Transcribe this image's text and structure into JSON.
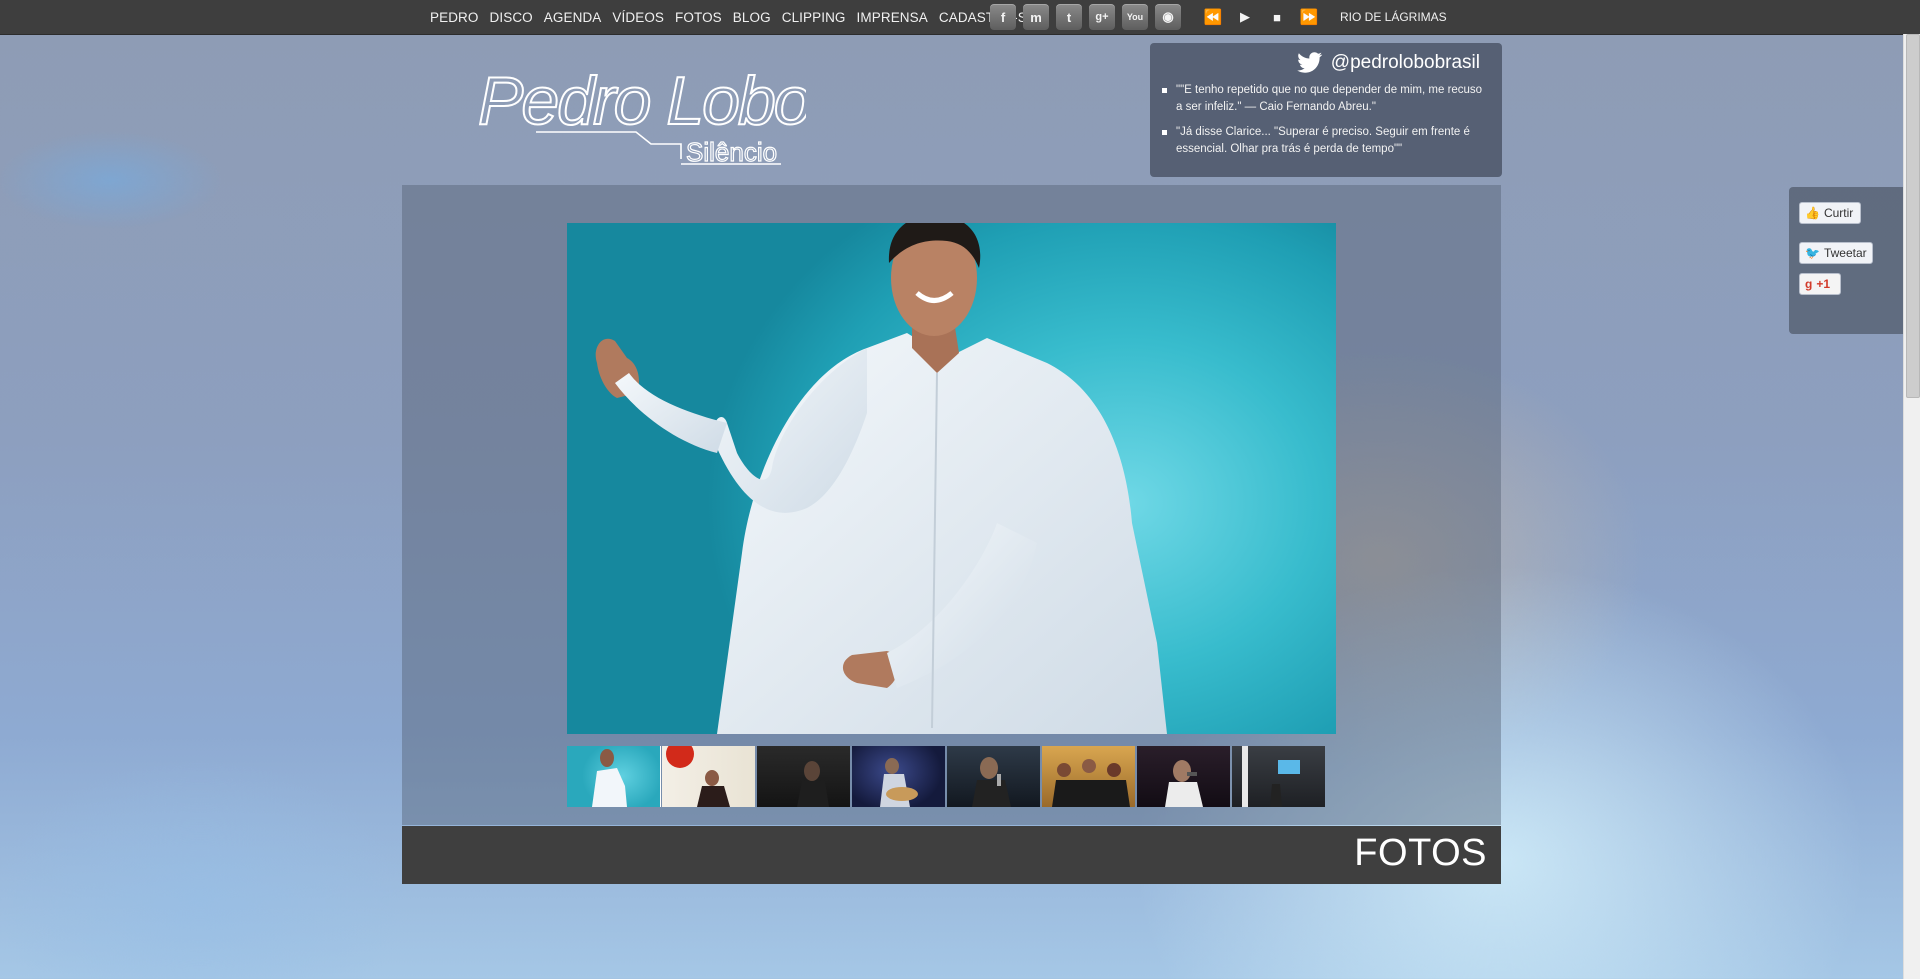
{
  "nav": {
    "items": [
      "PEDRO",
      "DISCO",
      "AGENDA",
      "VÍDEOS",
      "FOTOS",
      "BLOG",
      "CLIPPING",
      "IMPRENSA",
      "CADASTRE-SE"
    ]
  },
  "social": [
    {
      "icon": "facebook-icon",
      "glyph": "f"
    },
    {
      "icon": "myspace-icon",
      "glyph": "m"
    },
    {
      "icon": "twitter-icon",
      "glyph": "t"
    },
    {
      "icon": "google-plus-icon",
      "glyph": "g+"
    },
    {
      "icon": "youtube-icon",
      "glyph": "You"
    },
    {
      "icon": "lastfm-icon",
      "glyph": "◉"
    }
  ],
  "player": {
    "prev": "⏪",
    "play": "▶",
    "stop": "■",
    "next": "⏩",
    "song": "RIO DE LÁGRIMAS"
  },
  "logo": {
    "name": "Pedro Lobo",
    "subtitle": "Silêncio"
  },
  "twitter": {
    "handle": "@pedrolobobrasil",
    "tweets": [
      "\"\"E tenho repetido que no que depender de mim, me recuso a ser infeliz.\" — Caio Fernando Abreu.\"",
      "\"Já disse Clarice... \"Superar é preciso. Seguir em frente é essencial. Olhar pra trás é perda de tempo\"\""
    ]
  },
  "gallery": {
    "section_title": "FOTOS",
    "selected_index": 0,
    "thumbnail_count": 8
  },
  "share": {
    "like": "Curtir",
    "tweet": "Tweetar",
    "plusone": "+1"
  },
  "colors": {
    "topbar": "#3e3e3e",
    "photo_bg": "#38bccd",
    "fotos_bar": "#3f3f3f"
  }
}
